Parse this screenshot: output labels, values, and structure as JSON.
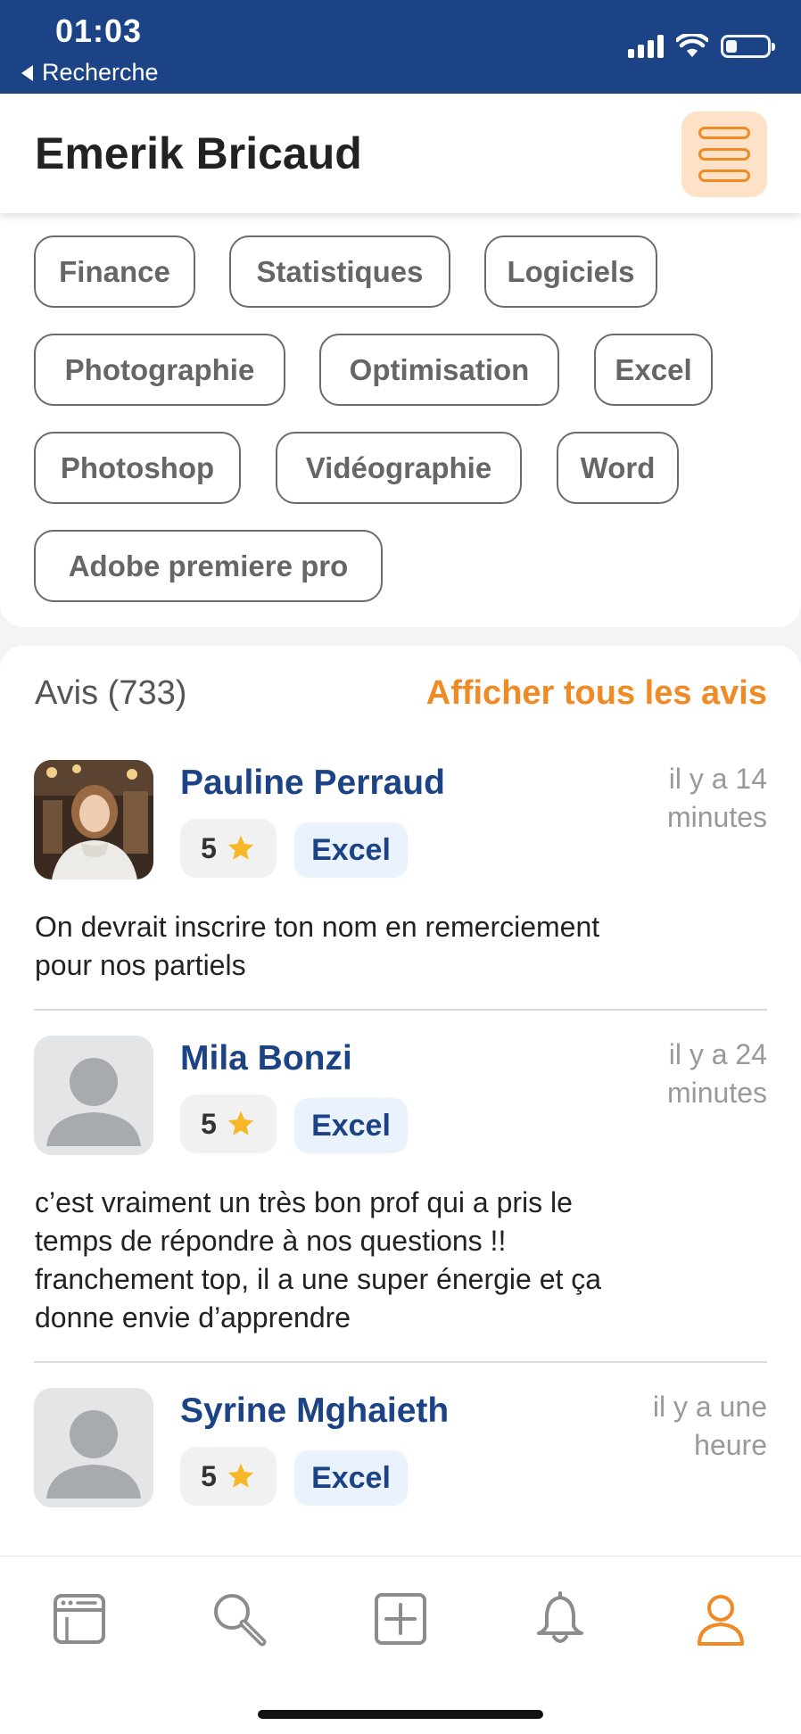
{
  "status_bar": {
    "time": "01:03",
    "back_label": "Recherche"
  },
  "header": {
    "name": "Emerik Bricaud",
    "menu_icon": "hamburger-icon"
  },
  "tags": [
    "Finance",
    "Statistiques",
    "Logiciels",
    "Photographie",
    "Optimisation",
    "Excel",
    "Photoshop",
    "Vidéographie",
    "Word",
    "Adobe premiere pro"
  ],
  "reviews_section": {
    "title": "Avis (733)",
    "show_all_label": "Afficher tous les avis"
  },
  "reviews": [
    {
      "name": "Pauline Perraud",
      "time_line1": "il y a 14",
      "time_line2": "minutes",
      "rating": "5",
      "subject": "Excel",
      "text_lines": [
        "On devrait inscrire ton nom en remerciement",
        "pour nos partiels"
      ],
      "avatar": "photo"
    },
    {
      "name": "Mila Bonzi",
      "time_line1": "il y a 24",
      "time_line2": "minutes",
      "rating": "5",
      "subject": "Excel",
      "text_lines": [
        "c’est vraiment un très bon prof qui a pris le",
        "temps de répondre à nos questions !!",
        "franchement top, il a une super énergie et ça",
        "donne envie d’apprendre"
      ],
      "avatar": "placeholder"
    },
    {
      "name": "Syrine Mghaieth",
      "time_line1": "il y a une",
      "time_line2": "heure",
      "rating": "5",
      "subject": "Excel",
      "text_lines": [],
      "avatar": "placeholder"
    }
  ],
  "bottom_nav": [
    {
      "icon": "browser-window-icon",
      "active": false
    },
    {
      "icon": "search-icon",
      "active": false
    },
    {
      "icon": "add-square-icon",
      "active": false
    },
    {
      "icon": "bell-icon",
      "active": false
    },
    {
      "icon": "user-icon",
      "active": true
    }
  ],
  "colors": {
    "primary_blue": "#1b4385",
    "accent_orange": "#f08a24",
    "menu_bg": "#fde2c7",
    "chip_bg": "#eaf3fd",
    "star": "#f6b728"
  }
}
